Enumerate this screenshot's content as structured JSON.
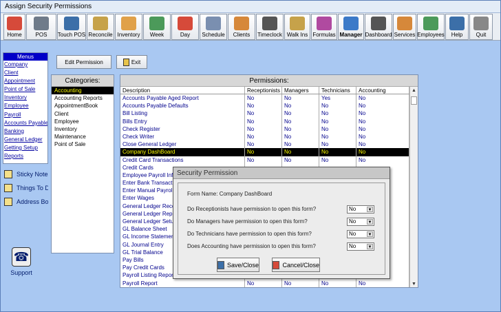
{
  "window": {
    "title": "Assign Security Permissions"
  },
  "toolbar": [
    {
      "label": "Home",
      "icon": "home-icon",
      "color": "#d64a3a",
      "w": 32,
      "bold": false
    },
    {
      "label": "POS",
      "icon": "pos-icon",
      "color": "#6f7b8a",
      "w": 44,
      "bold": false
    },
    {
      "label": "Touch POS",
      "icon": "touch-pos-icon",
      "color": "#3c6fa8",
      "w": 42,
      "bold": false
    },
    {
      "label": "Reconcile",
      "icon": "reconcile-icon",
      "color": "#c6a24a",
      "w": 40,
      "bold": false
    },
    {
      "label": "Inventory",
      "icon": "inventory-icon",
      "color": "#e0a14a",
      "w": 40,
      "bold": false
    },
    {
      "label": "Week",
      "icon": "week-calendar-icon",
      "color": "#4c9a5a",
      "w": 40,
      "bold": false
    },
    {
      "label": "Day",
      "icon": "day-calendar-icon",
      "color": "#d64a3a",
      "w": 40,
      "bold": false
    },
    {
      "label": "Schedule",
      "icon": "schedule-icon",
      "color": "#7a8fb0",
      "w": 40,
      "bold": false
    },
    {
      "label": "Clients",
      "icon": "clients-icon",
      "color": "#d6883a",
      "w": 40,
      "bold": false
    },
    {
      "label": "Timeclock",
      "icon": "timeclock-icon",
      "color": "#555555",
      "w": 40,
      "bold": false
    },
    {
      "label": "Walk Ins",
      "icon": "walk-ins-icon",
      "color": "#c6a24a",
      "w": 38,
      "bold": false
    },
    {
      "label": "Formulas",
      "icon": "formulas-icon",
      "color": "#b04aa0",
      "w": 38,
      "bold": false
    },
    {
      "label": "Manager",
      "icon": "manager-icon",
      "color": "#3c7ac8",
      "w": 38,
      "bold": true
    },
    {
      "label": "Dashboard",
      "icon": "dashboard-icon",
      "color": "#555555",
      "w": 40,
      "bold": false
    },
    {
      "label": "Services",
      "icon": "services-icon",
      "color": "#d6883a",
      "w": 34,
      "bold": false
    },
    {
      "label": "Employees",
      "icon": "employees-icon",
      "color": "#4c9a5a",
      "w": 40,
      "bold": false
    },
    {
      "label": "Help",
      "icon": "help-icon",
      "color": "#3c6fa8",
      "w": 34,
      "bold": false
    },
    {
      "label": "Quit",
      "icon": "quit-icon",
      "color": "#888888",
      "w": 34,
      "bold": false
    }
  ],
  "menus": {
    "header": "Menus",
    "items": [
      "Company",
      "Client",
      "Appointment",
      "Point of Sale",
      "Inventory",
      "Employee",
      "Payroll",
      "Accounts Payable",
      "Banking",
      "General Ledger",
      "Getting Setup",
      "Reports"
    ]
  },
  "side_links": [
    {
      "label": "Sticky Notes",
      "icon": "sticky-notes-icon"
    },
    {
      "label": "Things To Do",
      "icon": "things-to-do-icon"
    },
    {
      "label": "Address Book",
      "icon": "address-book-icon"
    }
  ],
  "support": {
    "label": "Support",
    "icon": "telephone-icon"
  },
  "actions": {
    "edit_permission": "Edit Permission",
    "exit": "Exit"
  },
  "categories": {
    "title": "Categories:",
    "items": [
      "Accounting",
      "Accounting Reports",
      "AppointmentBook",
      "Client",
      "Employee",
      "Inventory",
      "Maintenance",
      "Point of Sale"
    ],
    "selected_index": 0
  },
  "permissions": {
    "title": "Permissions:",
    "columns": [
      "Description",
      "Receptionists",
      "Managers",
      "Technicians",
      "Accounting"
    ],
    "rows": [
      [
        "Accounts Payable Aged Report",
        "No",
        "No",
        "Yes",
        "No"
      ],
      [
        "Accounts Payable Defaults",
        "No",
        "No",
        "No",
        "No"
      ],
      [
        "Bill Listing",
        "No",
        "No",
        "No",
        "No"
      ],
      [
        "Bills Entry",
        "No",
        "No",
        "No",
        "No"
      ],
      [
        "Check Register",
        "No",
        "No",
        "No",
        "No"
      ],
      [
        "Check Writer",
        "No",
        "No",
        "No",
        "No"
      ],
      [
        "Close General Ledger",
        "No",
        "No",
        "No",
        "No"
      ],
      [
        "Company DashBoard",
        "No",
        "No",
        "No",
        "No"
      ],
      [
        "Credit Card Transactions",
        "No",
        "No",
        "No",
        "No"
      ],
      [
        "Credit Cards",
        "",
        "",
        "",
        ""
      ],
      [
        "Employee Payroll Info",
        "",
        "",
        "",
        ""
      ],
      [
        "Enter Bank Transactions",
        "",
        "",
        "",
        ""
      ],
      [
        "Enter Manual Payroll",
        "",
        "",
        "",
        ""
      ],
      [
        "Enter Wages",
        "",
        "",
        "",
        ""
      ],
      [
        "General Ledger Reconcile",
        "",
        "",
        "",
        ""
      ],
      [
        "General Ledger Reports",
        "",
        "",
        "",
        ""
      ],
      [
        "General Ledger Setup",
        "",
        "",
        "",
        ""
      ],
      [
        "GL Balance Sheet",
        "",
        "",
        "",
        ""
      ],
      [
        "GL Income Statement",
        "",
        "",
        "",
        ""
      ],
      [
        "GL Journal Entry",
        "",
        "",
        "",
        ""
      ],
      [
        "GL Trial Balance",
        "",
        "",
        "",
        ""
      ],
      [
        "Pay Bills",
        "",
        "",
        "",
        ""
      ],
      [
        "Pay Credit Cards",
        "",
        "",
        "",
        ""
      ],
      [
        "Payroll Listing Report",
        "",
        "",
        "",
        ""
      ],
      [
        "Payroll Report",
        "No",
        "No",
        "No",
        "No"
      ]
    ],
    "selected_index": 7
  },
  "dialog": {
    "title": "Security Permission",
    "form_name_label": "Form Name:",
    "form_name_value": "Company DashBoard",
    "questions": [
      {
        "text": "Do Receptionists have permission to open this form?",
        "value": "No"
      },
      {
        "text": "Do Managers have permission to open this form?",
        "value": "No"
      },
      {
        "text": "Do Technicians have permission to open this form?",
        "value": "No"
      },
      {
        "text": "Does Accounting have permission to open this form?",
        "value": "No"
      }
    ],
    "save_label": "Save/Close",
    "cancel_label": "Cancel/Close"
  }
}
